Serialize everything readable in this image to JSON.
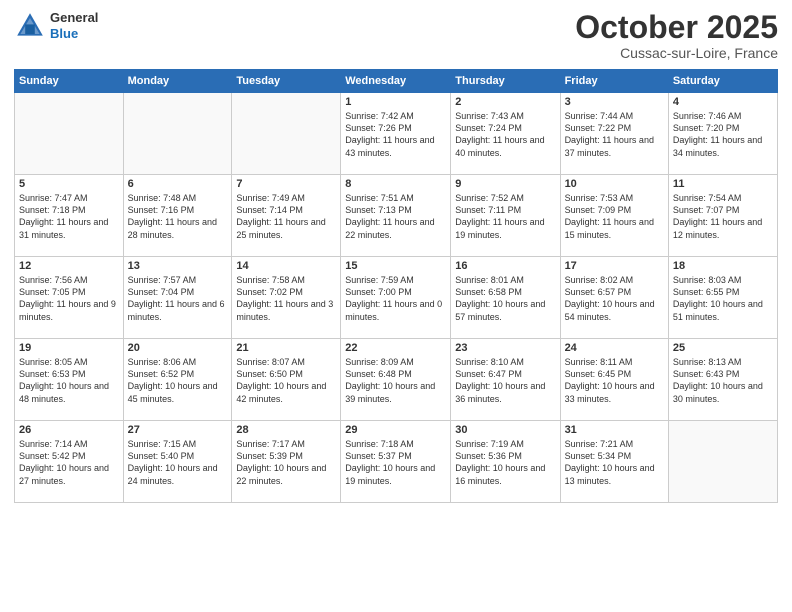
{
  "header": {
    "logo_line1": "General",
    "logo_line2": "Blue",
    "month": "October 2025",
    "location": "Cussac-sur-Loire, France"
  },
  "weekdays": [
    "Sunday",
    "Monday",
    "Tuesday",
    "Wednesday",
    "Thursday",
    "Friday",
    "Saturday"
  ],
  "weeks": [
    [
      {
        "day": "",
        "sunrise": "",
        "sunset": "",
        "daylight": ""
      },
      {
        "day": "",
        "sunrise": "",
        "sunset": "",
        "daylight": ""
      },
      {
        "day": "",
        "sunrise": "",
        "sunset": "",
        "daylight": ""
      },
      {
        "day": "1",
        "sunrise": "Sunrise: 7:42 AM",
        "sunset": "Sunset: 7:26 PM",
        "daylight": "Daylight: 11 hours and 43 minutes."
      },
      {
        "day": "2",
        "sunrise": "Sunrise: 7:43 AM",
        "sunset": "Sunset: 7:24 PM",
        "daylight": "Daylight: 11 hours and 40 minutes."
      },
      {
        "day": "3",
        "sunrise": "Sunrise: 7:44 AM",
        "sunset": "Sunset: 7:22 PM",
        "daylight": "Daylight: 11 hours and 37 minutes."
      },
      {
        "day": "4",
        "sunrise": "Sunrise: 7:46 AM",
        "sunset": "Sunset: 7:20 PM",
        "daylight": "Daylight: 11 hours and 34 minutes."
      }
    ],
    [
      {
        "day": "5",
        "sunrise": "Sunrise: 7:47 AM",
        "sunset": "Sunset: 7:18 PM",
        "daylight": "Daylight: 11 hours and 31 minutes."
      },
      {
        "day": "6",
        "sunrise": "Sunrise: 7:48 AM",
        "sunset": "Sunset: 7:16 PM",
        "daylight": "Daylight: 11 hours and 28 minutes."
      },
      {
        "day": "7",
        "sunrise": "Sunrise: 7:49 AM",
        "sunset": "Sunset: 7:14 PM",
        "daylight": "Daylight: 11 hours and 25 minutes."
      },
      {
        "day": "8",
        "sunrise": "Sunrise: 7:51 AM",
        "sunset": "Sunset: 7:13 PM",
        "daylight": "Daylight: 11 hours and 22 minutes."
      },
      {
        "day": "9",
        "sunrise": "Sunrise: 7:52 AM",
        "sunset": "Sunset: 7:11 PM",
        "daylight": "Daylight: 11 hours and 19 minutes."
      },
      {
        "day": "10",
        "sunrise": "Sunrise: 7:53 AM",
        "sunset": "Sunset: 7:09 PM",
        "daylight": "Daylight: 11 hours and 15 minutes."
      },
      {
        "day": "11",
        "sunrise": "Sunrise: 7:54 AM",
        "sunset": "Sunset: 7:07 PM",
        "daylight": "Daylight: 11 hours and 12 minutes."
      }
    ],
    [
      {
        "day": "12",
        "sunrise": "Sunrise: 7:56 AM",
        "sunset": "Sunset: 7:05 PM",
        "daylight": "Daylight: 11 hours and 9 minutes."
      },
      {
        "day": "13",
        "sunrise": "Sunrise: 7:57 AM",
        "sunset": "Sunset: 7:04 PM",
        "daylight": "Daylight: 11 hours and 6 minutes."
      },
      {
        "day": "14",
        "sunrise": "Sunrise: 7:58 AM",
        "sunset": "Sunset: 7:02 PM",
        "daylight": "Daylight: 11 hours and 3 minutes."
      },
      {
        "day": "15",
        "sunrise": "Sunrise: 7:59 AM",
        "sunset": "Sunset: 7:00 PM",
        "daylight": "Daylight: 11 hours and 0 minutes."
      },
      {
        "day": "16",
        "sunrise": "Sunrise: 8:01 AM",
        "sunset": "Sunset: 6:58 PM",
        "daylight": "Daylight: 10 hours and 57 minutes."
      },
      {
        "day": "17",
        "sunrise": "Sunrise: 8:02 AM",
        "sunset": "Sunset: 6:57 PM",
        "daylight": "Daylight: 10 hours and 54 minutes."
      },
      {
        "day": "18",
        "sunrise": "Sunrise: 8:03 AM",
        "sunset": "Sunset: 6:55 PM",
        "daylight": "Daylight: 10 hours and 51 minutes."
      }
    ],
    [
      {
        "day": "19",
        "sunrise": "Sunrise: 8:05 AM",
        "sunset": "Sunset: 6:53 PM",
        "daylight": "Daylight: 10 hours and 48 minutes."
      },
      {
        "day": "20",
        "sunrise": "Sunrise: 8:06 AM",
        "sunset": "Sunset: 6:52 PM",
        "daylight": "Daylight: 10 hours and 45 minutes."
      },
      {
        "day": "21",
        "sunrise": "Sunrise: 8:07 AM",
        "sunset": "Sunset: 6:50 PM",
        "daylight": "Daylight: 10 hours and 42 minutes."
      },
      {
        "day": "22",
        "sunrise": "Sunrise: 8:09 AM",
        "sunset": "Sunset: 6:48 PM",
        "daylight": "Daylight: 10 hours and 39 minutes."
      },
      {
        "day": "23",
        "sunrise": "Sunrise: 8:10 AM",
        "sunset": "Sunset: 6:47 PM",
        "daylight": "Daylight: 10 hours and 36 minutes."
      },
      {
        "day": "24",
        "sunrise": "Sunrise: 8:11 AM",
        "sunset": "Sunset: 6:45 PM",
        "daylight": "Daylight: 10 hours and 33 minutes."
      },
      {
        "day": "25",
        "sunrise": "Sunrise: 8:13 AM",
        "sunset": "Sunset: 6:43 PM",
        "daylight": "Daylight: 10 hours and 30 minutes."
      }
    ],
    [
      {
        "day": "26",
        "sunrise": "Sunrise: 7:14 AM",
        "sunset": "Sunset: 5:42 PM",
        "daylight": "Daylight: 10 hours and 27 minutes."
      },
      {
        "day": "27",
        "sunrise": "Sunrise: 7:15 AM",
        "sunset": "Sunset: 5:40 PM",
        "daylight": "Daylight: 10 hours and 24 minutes."
      },
      {
        "day": "28",
        "sunrise": "Sunrise: 7:17 AM",
        "sunset": "Sunset: 5:39 PM",
        "daylight": "Daylight: 10 hours and 22 minutes."
      },
      {
        "day": "29",
        "sunrise": "Sunrise: 7:18 AM",
        "sunset": "Sunset: 5:37 PM",
        "daylight": "Daylight: 10 hours and 19 minutes."
      },
      {
        "day": "30",
        "sunrise": "Sunrise: 7:19 AM",
        "sunset": "Sunset: 5:36 PM",
        "daylight": "Daylight: 10 hours and 16 minutes."
      },
      {
        "day": "31",
        "sunrise": "Sunrise: 7:21 AM",
        "sunset": "Sunset: 5:34 PM",
        "daylight": "Daylight: 10 hours and 13 minutes."
      },
      {
        "day": "",
        "sunrise": "",
        "sunset": "",
        "daylight": ""
      }
    ]
  ]
}
